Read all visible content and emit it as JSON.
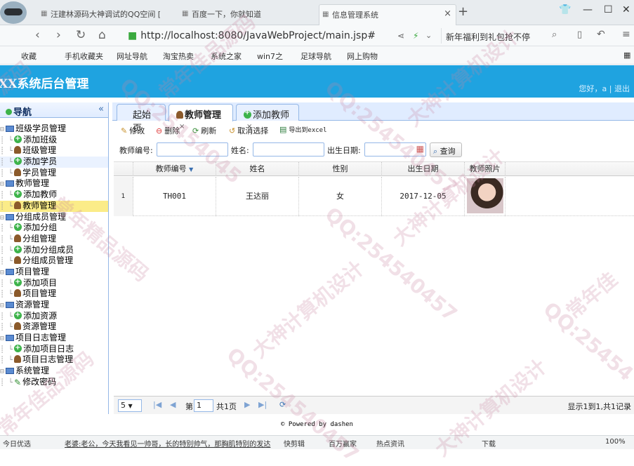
{
  "browser": {
    "tabs": [
      {
        "label": "汪建林源码大神调试的QQ空间 [",
        "active": false
      },
      {
        "label": "百度一下，你就知道",
        "active": false
      },
      {
        "label": "信息管理系统",
        "active": true
      }
    ],
    "url": "http://localhost:8080/JavaWebProject/main.jsp#",
    "search_text": "新年福利到礼包抢不停",
    "bookmarks": [
      "收藏",
      "手机收藏夹",
      "网址导航",
      "淘宝热卖",
      "系统之家",
      "win7之",
      "足球导航",
      "网上购物"
    ]
  },
  "app": {
    "title": "XX系统后台管理",
    "user_text": "您好，a | 退出"
  },
  "nav": {
    "title": "导航",
    "collapse": "«",
    "tree": [
      {
        "label": "班级学员管理",
        "icon": "folder-icon",
        "level": 0
      },
      {
        "label": "添加班级",
        "icon": "plus-icon",
        "level": 1
      },
      {
        "label": "班级管理",
        "icon": "person-icon",
        "level": 1
      },
      {
        "label": "添加学员",
        "icon": "plus-icon",
        "level": 1
      },
      {
        "label": "学员管理",
        "icon": "person-icon",
        "level": 1
      },
      {
        "label": "教师管理",
        "icon": "folder-icon",
        "level": 0
      },
      {
        "label": "添加教师",
        "icon": "plus-icon",
        "level": 1
      },
      {
        "label": "教师管理",
        "icon": "person-icon",
        "level": 1
      },
      {
        "label": "分组成员管理",
        "icon": "folder-icon",
        "level": 0
      },
      {
        "label": "添加分组",
        "icon": "plus-icon",
        "level": 1
      },
      {
        "label": "分组管理",
        "icon": "person-icon",
        "level": 1
      },
      {
        "label": "添加分组成员",
        "icon": "plus-icon",
        "level": 1
      },
      {
        "label": "分组成员管理",
        "icon": "person-icon",
        "level": 1
      },
      {
        "label": "项目管理",
        "icon": "folder-icon",
        "level": 0
      },
      {
        "label": "添加项目",
        "icon": "plus-icon",
        "level": 1
      },
      {
        "label": "项目管理",
        "icon": "person-icon",
        "level": 1
      },
      {
        "label": "资源管理",
        "icon": "folder-icon",
        "level": 0
      },
      {
        "label": "添加资源",
        "icon": "plus-icon",
        "level": 1
      },
      {
        "label": "资源管理",
        "icon": "person-icon",
        "level": 1
      },
      {
        "label": "项目日志管理",
        "icon": "folder-icon",
        "level": 0
      },
      {
        "label": "添加项目日志",
        "icon": "plus-icon",
        "level": 1
      },
      {
        "label": "项目日志管理",
        "icon": "person-icon",
        "level": 1
      },
      {
        "label": "系统管理",
        "icon": "folder-icon",
        "level": 0
      },
      {
        "label": "修改密码",
        "icon": "pencil-icon",
        "level": 1
      }
    ]
  },
  "tabs": [
    {
      "label": "起始页",
      "closable": false
    },
    {
      "label": "教师管理",
      "closable": true
    },
    {
      "label": "添加教师",
      "closable": true
    }
  ],
  "toolbar": {
    "edit": "修改",
    "delete": "删除",
    "refresh": "刷新",
    "unselect": "取消选择",
    "export": "导出到excel"
  },
  "filter": {
    "teacher_no_label": "教师编号:",
    "name_label": "姓名:",
    "birth_label": "出生日期:",
    "query_button": "查询"
  },
  "table": {
    "headers": [
      "教师编号",
      "姓名",
      "性别",
      "出生日期",
      "教师照片"
    ],
    "rows": [
      {
        "index": "1",
        "teacher_no": "TH001",
        "name": "王达丽",
        "gender": "女",
        "birth": "2017-12-05"
      }
    ]
  },
  "pager": {
    "page_size": "5",
    "page_label_pre": "第",
    "page_value": "1",
    "page_label_post": "共1页",
    "summary": "显示1到1,共1记录"
  },
  "footer": "© Powered by dashen",
  "statusbar": [
    "今日优选",
    "老婆:老公，今天我看见一帅哥，长的特别帅气，那胸肌特别的发达",
    "快剪辑",
    "百万赢家",
    "热点资讯",
    "下载",
    "100%"
  ],
  "watermarks": [
    "源码",
    "常年佳品源码",
    "大神计算机设计",
    "QQ:25454045",
    "QQ:254540457",
    "大神计算机设计",
    "常年精品源码",
    "QQ:254540457",
    "大神计算机设计",
    "常年佳",
    "QQ:25454",
    "大神计算机设计",
    "常年佳品源码",
    "QQ:254540457"
  ]
}
